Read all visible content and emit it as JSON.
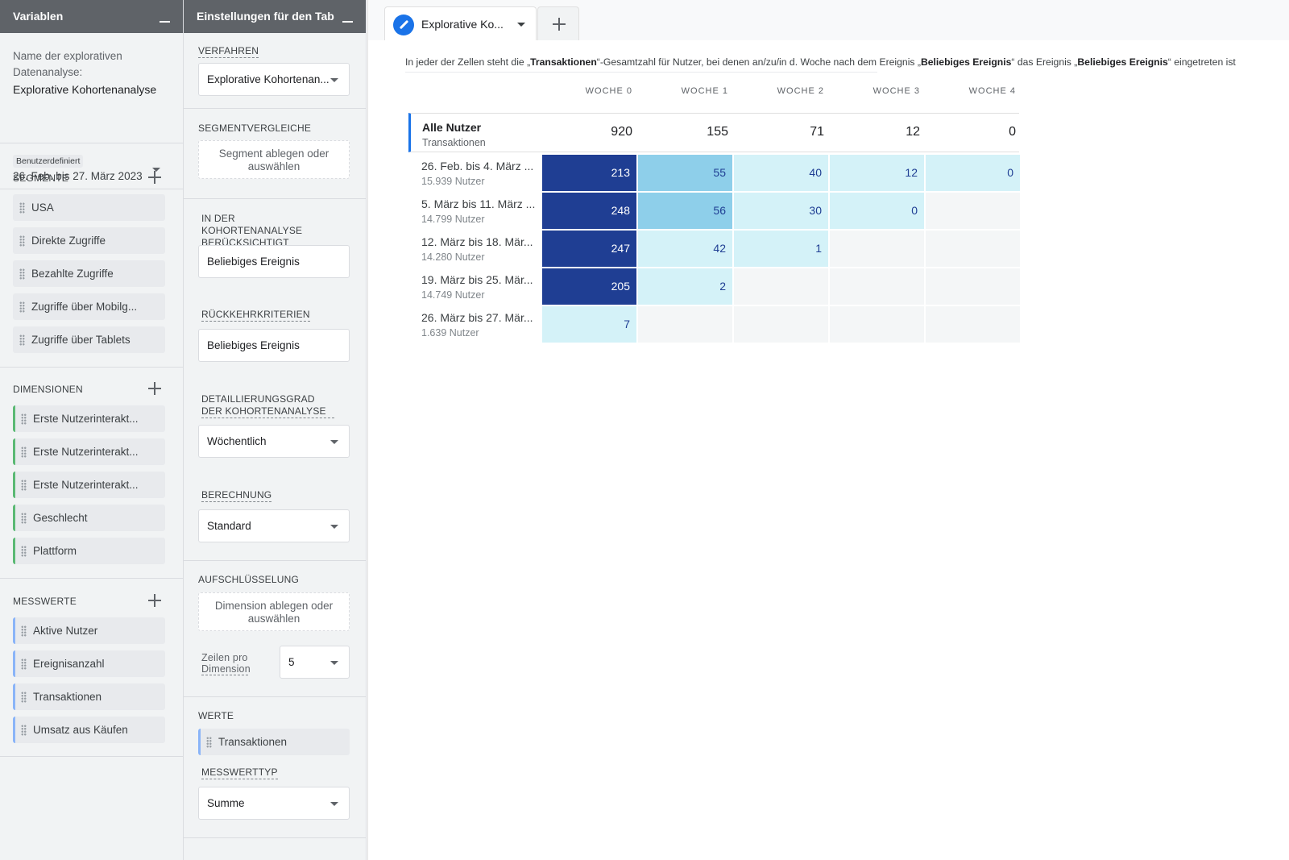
{
  "variables_panel": {
    "title": "Variablen",
    "exploration_name_label": "Name der explorativen Datenanalyse:",
    "exploration_name_value": "Explorative Kohortenanalyse",
    "date_chip_label": "Benutzerdefiniert",
    "date_range": "26. Feb. bis 27. März 2023",
    "segments": {
      "title": "SEGMENTE",
      "items": [
        "USA",
        "Direkte Zugriffe",
        "Bezahlte Zugriffe",
        "Zugriffe über Mobilg...",
        "Zugriffe über Tablets"
      ]
    },
    "dimensions": {
      "title": "DIMENSIONEN",
      "items": [
        "Erste Nutzerinterakt...",
        "Erste Nutzerinterakt...",
        "Erste Nutzerinterakt...",
        "Geschlecht",
        "Plattform"
      ]
    },
    "metrics": {
      "title": "MESSWERTE",
      "items": [
        "Aktive Nutzer",
        "Ereignisanzahl",
        "Transaktionen",
        "Umsatz aus Käufen"
      ]
    }
  },
  "settings_panel": {
    "title": "Einstellungen für den Tab",
    "technique_label": "VERFAHREN",
    "technique_value": "Explorative Kohortenan...",
    "segment_compare_label": "SEGMENTVERGLEICHE",
    "segment_drop_text": "Segment ablegen oder auswählen",
    "cohort_inclusion_label": "IN DER KOHORTENANALYSE BERÜCKSICHTIGT",
    "cohort_inclusion_value": "Beliebiges Ereignis",
    "return_criteria_label": "RÜCKKEHRKRITERIEN",
    "return_criteria_value": "Beliebiges Ereignis",
    "granularity_label": "DETAILLIERUNGSGRAD DER KOHORTENANALYSE",
    "granularity_value": "Wöchentlich",
    "calculation_label": "BERECHNUNG",
    "calculation_value": "Standard",
    "breakdown_label": "AUFSCHLÜSSELUNG",
    "breakdown_drop_text": "Dimension ablegen oder auswählen",
    "rows_per_dimension_label": "Zeilen pro Dimension",
    "rows_per_dimension_value": "5",
    "values_label": "WERTE",
    "values_item": "Transaktionen",
    "metric_type_label": "MESSWERTTYP",
    "metric_type_value": "Summe"
  },
  "tab": {
    "title": "Explorative Ko..."
  },
  "cohort": {
    "description_parts": [
      "In jeder der Zellen steht die „",
      "Transaktionen",
      "“-Gesamtzahl für Nutzer, bei denen an/zu/in d. Woche nach dem Ereignis „",
      "Beliebiges Ereignis",
      "“ das Ereignis „",
      "Beliebiges Ereignis",
      "“ eingetreten ist"
    ],
    "weeks": [
      "WOCHE 0",
      "WOCHE 1",
      "WOCHE 2",
      "WOCHE 3",
      "WOCHE 4"
    ],
    "total": {
      "label": "Alle Nutzer",
      "sublabel": "Transaktionen",
      "values": [
        "920",
        "155",
        "71",
        "12",
        "0"
      ]
    },
    "rows": [
      {
        "label": "26. Feb. bis 4. März ...",
        "users": "15.939 Nutzer",
        "values": [
          213,
          55,
          40,
          12,
          0
        ]
      },
      {
        "label": "5. März bis 11. März ...",
        "users": "14.799 Nutzer",
        "values": [
          248,
          56,
          30,
          0
        ]
      },
      {
        "label": "12. März bis 18. Mär...",
        "users": "14.280 Nutzer",
        "values": [
          247,
          42,
          1
        ]
      },
      {
        "label": "19. März bis 25. Mär...",
        "users": "14.749 Nutzer",
        "values": [
          205,
          2
        ]
      },
      {
        "label": "26. März bis 27. Mär...",
        "users": "1.639 Nutzer",
        "values": [
          7
        ]
      }
    ],
    "colors": {
      "dark": "#1f3e93",
      "medium": "#8ecfea",
      "light": "#d4f2f8",
      "empty": "#f4f6f7",
      "text_on_dark": "#ffffff",
      "text_on_light": "#1f3e93"
    }
  }
}
